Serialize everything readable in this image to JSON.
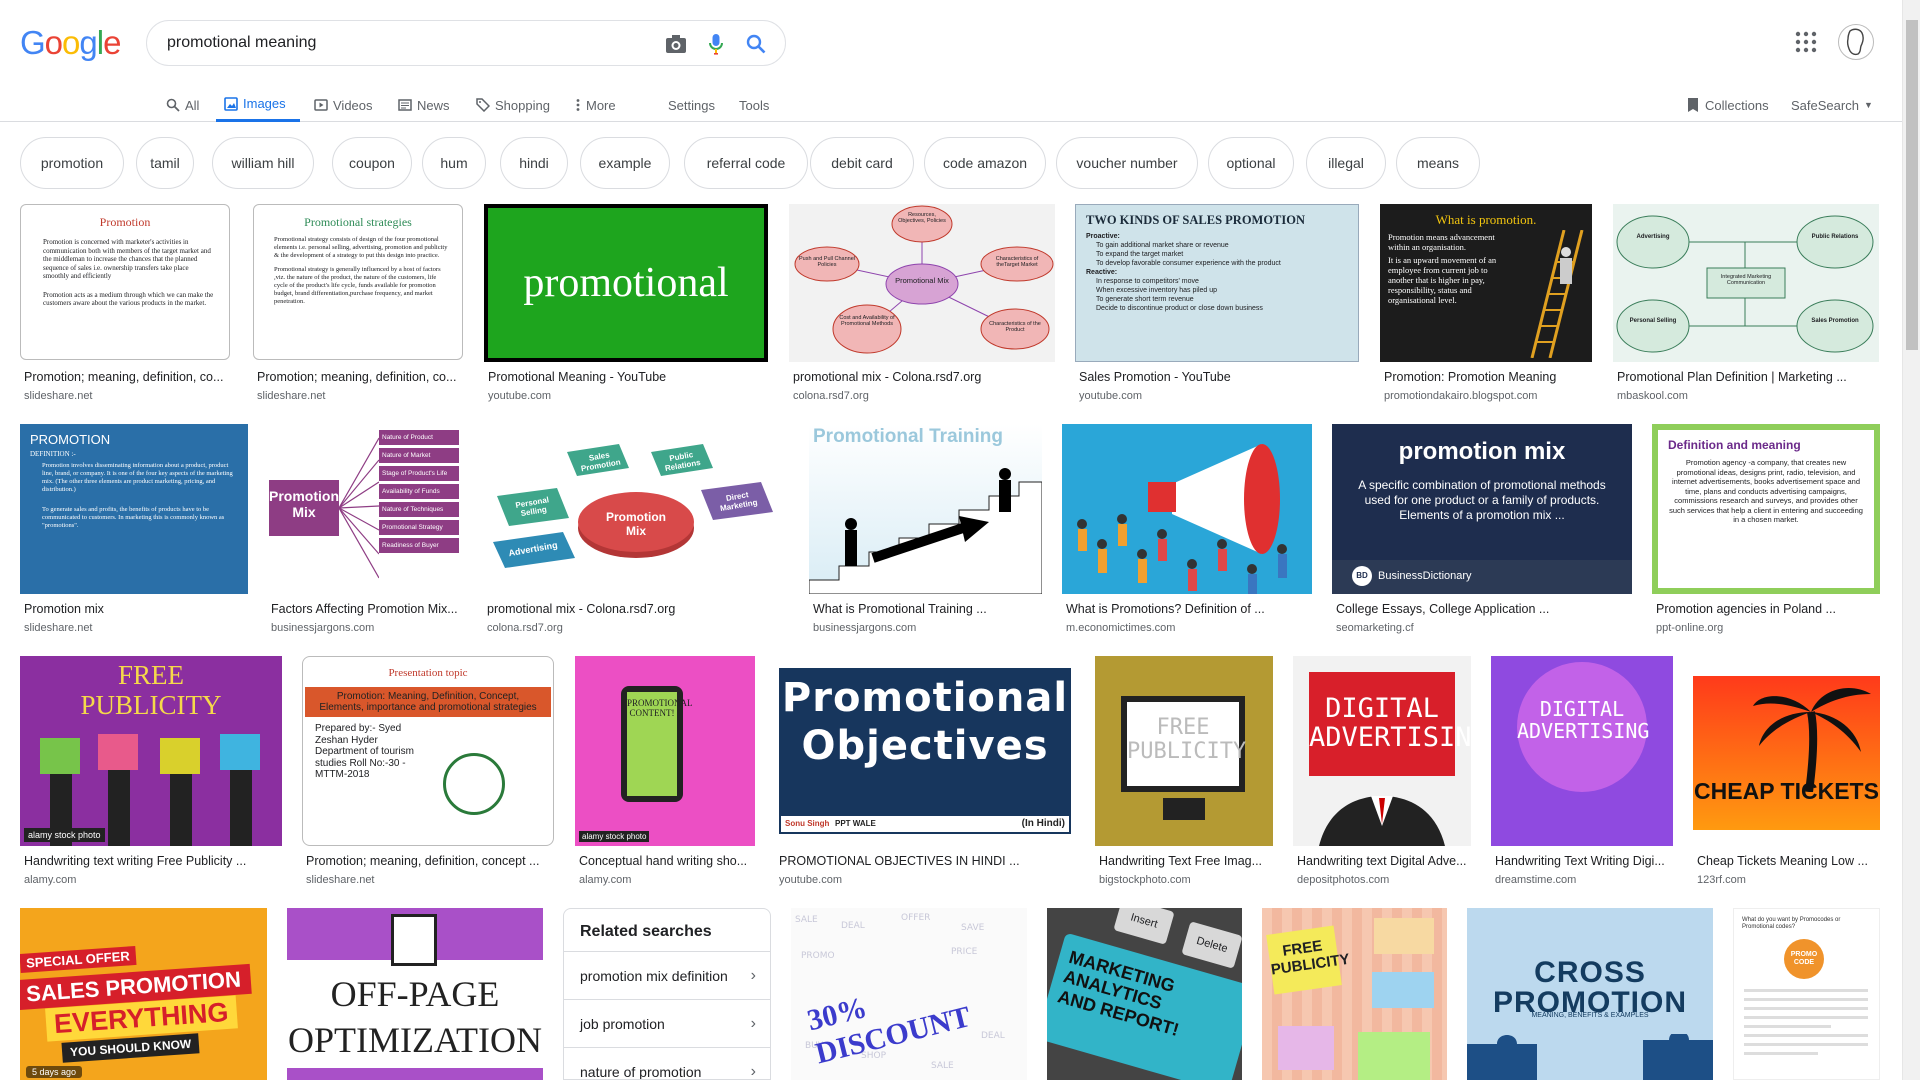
{
  "search": {
    "query": "promotional meaning"
  },
  "logo": {
    "letters": [
      "G",
      "o",
      "o",
      "g",
      "l",
      "e"
    ],
    "colors": [
      "#4285F4",
      "#EA4335",
      "#FBBC05",
      "#4285F4",
      "#34A853",
      "#EA4335"
    ]
  },
  "tabs": {
    "all": "All",
    "images": "Images",
    "videos": "Videos",
    "news": "News",
    "shopping": "Shopping",
    "more": "More",
    "settings": "Settings",
    "tools": "Tools",
    "collections": "Collections",
    "safesearch": "SafeSearch"
  },
  "chips": [
    "promotion",
    "tamil",
    "william hill",
    "coupon",
    "hum",
    "hindi",
    "example",
    "referral code",
    "debit card",
    "code amazon",
    "voucher number",
    "optional",
    "illegal",
    "means"
  ],
  "results": [
    {
      "caption": "Promotion; meaning, definition, co...",
      "source": "slideshare.net",
      "title": "Promotion",
      "lines": [
        "Promotion is concerned with marketer's activities in communication both with members of the target market and the middleman to increase the chances that the planned sequence of sales i.e. ownership transfers take place smoothly and efficiently",
        "Promotion acts as a medium through which we can make the customers aware about the various products in the market."
      ]
    },
    {
      "caption": "Promotion; meaning, definition, co...",
      "source": "slideshare.net",
      "title": "Promotional strategies",
      "lines": [
        "Promotional strategy consists of design of the four promotional elements i.e. personal selling, advertising, promotion and publicity & the development of a strategy to put this design into practice.",
        "Promotional strategy is generally influenced by a host of factors ,viz. the nature of the product, the nature of the customers, life cycle of the product's life cycle, funds available for promotion budget, brand differentiation,purchase frequency, and market penetration."
      ]
    },
    {
      "caption": "Promotional Meaning - YouTube",
      "source": "youtube.com",
      "title": "promotional"
    },
    {
      "caption": "promotional mix - Colona.rsd7.org",
      "source": "colona.rsd7.org",
      "center": "Promotional Mix",
      "nodes": [
        "Resources, Objectives, Policies",
        "Characteristics of theTarget Market",
        "Characteristics of the Product",
        "Cost and Availability of Promotional Methods",
        "Push and Pull Channel Policies"
      ]
    },
    {
      "caption": "Sales Promotion - YouTube",
      "source": "youtube.com",
      "title": "TWO KINDS OF SALES PROMOTION",
      "lines": [
        "Proactive:",
        "To gain additional market share or revenue",
        "To expand the target market",
        "To develop favorable consumer experience with the product",
        "Reactive:",
        "In response to competitors' move",
        "When excessive inventory has piled up",
        "To generate short term revenue",
        "Decide to discontinue product or close down business"
      ]
    },
    {
      "caption": "Promotion: Promotion Meaning",
      "source": "promotiondakairo.blogspot.com",
      "title": "What is promotion.",
      "lines": [
        "Promotion means advancement within an organisation.",
        "It is an upward movement of an employee from current job to another that is higher in pay, responsibility, status and organisational level."
      ]
    },
    {
      "caption": "Promotional Plan Definition | Marketing ...",
      "source": "mbaskool.com",
      "nodes": [
        "Advertising",
        "Public Relations",
        "Integrated Marketing Communication",
        "Personal Selling",
        "Sales Promotion"
      ]
    },
    {
      "caption": "Promotion mix",
      "source": "slideshare.net",
      "title": "PROMOTION",
      "lines": [
        "DEFINITION :-",
        "Promotion involves disseminating information about a product, product line, brand, or company. It is one of the four key aspects of the marketing mix. (The other three elements are product marketing, pricing, and distribution.)",
        "To generate sales and profits, the benefits of products have to be communicated to customers. In marketing this is commonly known as \"promotions\"."
      ]
    },
    {
      "caption": "Factors Affecting Promotion Mix...",
      "source": "businessjargons.com",
      "title": "Promotion Mix",
      "nodes": [
        "Nature of Product",
        "Nature of Market",
        "Stage of Product's Life",
        "Availability of Funds",
        "Nature of Techniques",
        "Promotional Strategy",
        "Readiness of Buyer"
      ]
    },
    {
      "caption": "promotional mix - Colona.rsd7.org",
      "source": "colona.rsd7.org",
      "center": "Promotion Mix",
      "nodes": [
        "Personal Selling",
        "Sales Promotion",
        "Public Relations",
        "Direct Marketing",
        "Advertising"
      ]
    },
    {
      "caption": "What is Promotional Training ...",
      "source": "businessjargons.com",
      "title": "Promotional Training"
    },
    {
      "caption": "What is Promotions? Definition of ...",
      "source": "m.economictimes.com"
    },
    {
      "caption": "College Essays, College Application ...",
      "source": "seomarketing.cf",
      "title": "promotion mix",
      "lines": [
        "A specific combination of promotional methods used for one product or a family of products. Elements of a promotion mix ..."
      ],
      "brand": "BusinessDictionary"
    },
    {
      "caption": "Promotion agencies in Poland ...",
      "source": "ppt-online.org",
      "title": "Definition and meaning",
      "lines": [
        "Promotion agency -a company, that creates new promotional ideas, designs print, radio, television, and internet advertisements, books advertisement space and time, plans and conducts advertising campaigns, commissions research and surveys, and provides other such services that help a client in entering and succeeding in a chosen market."
      ]
    },
    {
      "caption": "Handwriting text writing Free Publicity ...",
      "source": "alamy.com",
      "title": "FREE PUBLICITY",
      "badge": "alamy stock photo"
    },
    {
      "caption": "Promotion; meaning, definition, concept ...",
      "source": "slideshare.net",
      "title": "Presentation topic",
      "lines": [
        "Promotion: Meaning, Definition, Concept, Elements, importance and promotional strategies",
        "Prepared by:- Syed Zeshan Hyder Department of tourism studies Roll No:-30 - MTTM-2018"
      ]
    },
    {
      "caption": "Conceptual hand writing sho...",
      "source": "alamy.com",
      "title": "PROMOTIONAL CONTENT!",
      "badge": "alamy stock photo"
    },
    {
      "caption": "PROMOTIONAL OBJECTIVES IN HINDI ...",
      "source": "youtube.com",
      "title": "Promotional Objectives",
      "lines": [
        "Sonu Singh",
        "PPT WALE",
        "(In Hindi)"
      ]
    },
    {
      "caption": "Handwriting Text Free Imag...",
      "source": "bigstockphoto.com",
      "title": "FREE PUBLICITY"
    },
    {
      "caption": "Handwriting text Digital Adve...",
      "source": "depositphotos.com",
      "title": "DIGITAL ADVERTISING"
    },
    {
      "caption": "Handwriting Text Writing Digi...",
      "source": "dreamstime.com",
      "title": "DIGITAL ADVERTISING"
    },
    {
      "caption": "Cheap Tickets Meaning Low ...",
      "source": "123rf.com",
      "title": "CHEAP TICKETS"
    },
    {
      "lines": [
        "SPECIAL OFFER",
        "SALES PROMOTION",
        "EVERYTHING",
        "YOU SHOULD KNOW"
      ],
      "badge": "5 days ago"
    },
    {
      "lines": [
        "OFF-PAGE",
        "OPTIMIZATION"
      ]
    },
    {
      "title": "30% DISCOUNT"
    },
    {
      "lines": [
        "MARKETING ANALYTICS",
        "AND REPORT!",
        "Insert",
        "Delete"
      ]
    },
    {
      "title": "FREE PUBLICITY"
    },
    {
      "title": "CROSS PROMOTION",
      "lines": [
        "MEANING, BENEFITS & EXAMPLES"
      ]
    },
    {
      "lines": [
        "What do you want by Promocodes or Promotional codes?",
        "PROMO CODE"
      ]
    }
  ],
  "related": {
    "title": "Related searches",
    "items": [
      "promotion mix definition",
      "job promotion",
      "nature of promotion"
    ]
  }
}
